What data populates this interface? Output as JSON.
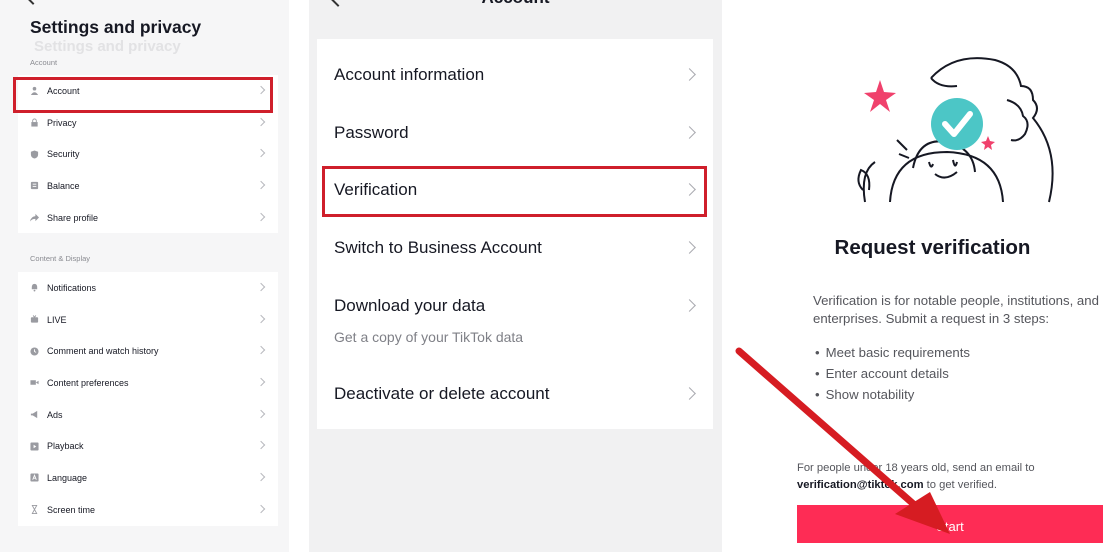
{
  "settings": {
    "title": "Settings and privacy",
    "ghost_text": "Settings and privacy",
    "sections": [
      {
        "label": "Account",
        "items": [
          {
            "label": "Account",
            "icon": "person-icon"
          },
          {
            "label": "Privacy",
            "icon": "lock-icon"
          },
          {
            "label": "Security",
            "icon": "shield-icon"
          },
          {
            "label": "Balance",
            "icon": "wallet-icon"
          },
          {
            "label": "Share profile",
            "icon": "share-icon"
          }
        ]
      },
      {
        "label": "Content & Display",
        "items": [
          {
            "label": "Notifications",
            "icon": "bell-icon"
          },
          {
            "label": "LIVE",
            "icon": "live-icon"
          },
          {
            "label": "Comment and watch history",
            "icon": "clock-icon"
          },
          {
            "label": "Content preferences",
            "icon": "video-icon"
          },
          {
            "label": "Ads",
            "icon": "megaphone-icon"
          },
          {
            "label": "Playback",
            "icon": "play-icon"
          },
          {
            "label": "Language",
            "icon": "language-icon"
          },
          {
            "label": "Screen time",
            "icon": "hourglass-icon"
          }
        ]
      }
    ]
  },
  "account": {
    "title": "Account",
    "items": [
      {
        "label": "Account information"
      },
      {
        "label": "Password"
      },
      {
        "label": "Verification"
      },
      {
        "label": "Switch to Business Account"
      },
      {
        "label": "Download your data",
        "sublabel": "Get a copy of your TikTok data"
      },
      {
        "label": "Deactivate or delete account"
      }
    ]
  },
  "verification": {
    "heading": "Request verification",
    "intro": "Verification is for notable people, institutions, and enterprises. Submit a request in 3 steps:",
    "steps": [
      "Meet basic requirements",
      "Enter account details",
      "Show notability"
    ],
    "note_prefix": "For people under 18 years old, send an email to ",
    "note_email": "verification@tiktok.com",
    "note_suffix": " to get verified.",
    "start_label": "Start"
  },
  "colors": {
    "highlight": "#cf1f2b",
    "start_button": "#fe2c55",
    "arrow": "#d61c22",
    "badge_teal": "#4cc6c6",
    "star_pink": "#f0416c"
  }
}
